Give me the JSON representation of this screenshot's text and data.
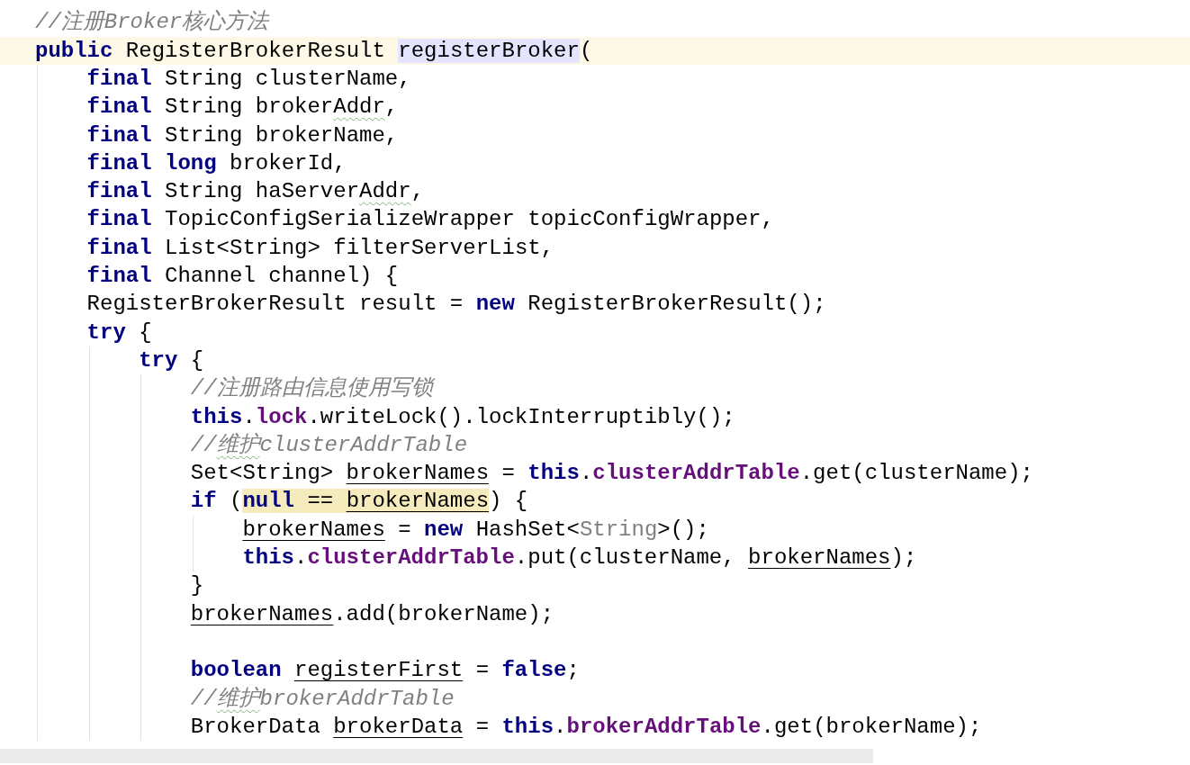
{
  "editor": {
    "lines": [
      {
        "tokens": [
          {
            "text": "//注册Broker核心方法",
            "kind": "comment"
          }
        ]
      },
      {
        "current": true,
        "tokens": [
          {
            "text": "public",
            "kind": "keyword"
          },
          {
            "text": " RegisterBrokerResult ",
            "kind": "plain"
          },
          {
            "text": "registerBroker",
            "kind": "plain",
            "color": "#e4e4ff"
          },
          {
            "text": "(",
            "kind": "plain"
          }
        ],
        "children": [
          {
            "tokens": [
              {
                "text": "final",
                "kind": "keyword"
              },
              {
                "text": " String clusterName,",
                "kind": "plain"
              }
            ]
          },
          {
            "tokens": [
              {
                "text": "final",
                "kind": "keyword"
              },
              {
                "text": " String broker",
                "kind": "plain"
              },
              {
                "text": "Addr",
                "kind": "plain",
                "typo": true
              },
              {
                "text": ",",
                "kind": "plain"
              }
            ]
          },
          {
            "tokens": [
              {
                "text": "final",
                "kind": "keyword"
              },
              {
                "text": " String brokerName,",
                "kind": "plain"
              }
            ]
          },
          {
            "tokens": [
              {
                "text": "final",
                "kind": "keyword"
              },
              {
                "text": " long",
                "kind": "keyword"
              },
              {
                "text": " brokerId,",
                "kind": "plain"
              }
            ]
          },
          {
            "tokens": [
              {
                "text": "final",
                "kind": "keyword"
              },
              {
                "text": " String haServer",
                "kind": "plain"
              },
              {
                "text": "Addr",
                "kind": "plain",
                "typo": true
              },
              {
                "text": ",",
                "kind": "plain"
              }
            ]
          },
          {
            "tokens": [
              {
                "text": "final",
                "kind": "keyword"
              },
              {
                "text": " TopicConfigSerializeWrapper topicConfigWrapper,",
                "kind": "plain"
              }
            ]
          },
          {
            "tokens": [
              {
                "text": "final",
                "kind": "keyword"
              },
              {
                "text": " List<String> filterServerList,",
                "kind": "plain"
              }
            ]
          },
          {
            "tokens": [
              {
                "text": "final",
                "kind": "keyword"
              },
              {
                "text": " Channel channel) {",
                "kind": "plain"
              }
            ]
          },
          {
            "tokens": [
              {
                "text": "RegisterBrokerResult result = ",
                "kind": "plain"
              },
              {
                "text": "new",
                "kind": "keyword"
              },
              {
                "text": " RegisterBrokerResult();",
                "kind": "plain"
              }
            ]
          },
          {
            "tokens": [
              {
                "text": "try",
                "kind": "keyword"
              },
              {
                "text": " {",
                "kind": "plain"
              }
            ],
            "children": [
              {
                "tokens": [
                  {
                    "text": "try",
                    "kind": "keyword"
                  },
                  {
                    "text": " {",
                    "kind": "plain"
                  }
                ],
                "children": [
                  {
                    "tokens": [
                      {
                        "text": "//注册路由信息使用写锁",
                        "kind": "comment"
                      }
                    ]
                  },
                  {
                    "tokens": [
                      {
                        "text": "this",
                        "kind": "keyword"
                      },
                      {
                        "text": ".",
                        "kind": "plain"
                      },
                      {
                        "text": "lock",
                        "kind": "field"
                      },
                      {
                        "text": ".writeLock().lockInterruptibly();",
                        "kind": "plain"
                      }
                    ]
                  },
                  {
                    "tokens": [
                      {
                        "text": "//",
                        "kind": "comment"
                      },
                      {
                        "text": "维护",
                        "kind": "comment",
                        "typo": true
                      },
                      {
                        "text": "clusterAddrTable",
                        "kind": "comment"
                      }
                    ]
                  },
                  {
                    "tokens": [
                      {
                        "text": "Set<String> ",
                        "kind": "plain"
                      },
                      {
                        "text": "brokerNames",
                        "kind": "variable"
                      },
                      {
                        "text": " = ",
                        "kind": "plain"
                      },
                      {
                        "text": "this",
                        "kind": "keyword"
                      },
                      {
                        "text": ".",
                        "kind": "plain"
                      },
                      {
                        "text": "clusterAddrTable",
                        "kind": "field"
                      },
                      {
                        "text": ".get(clusterName);",
                        "kind": "plain"
                      }
                    ]
                  },
                  {
                    "tokens": [
                      {
                        "text": "if",
                        "kind": "keyword"
                      },
                      {
                        "text": " (",
                        "kind": "plain"
                      },
                      {
                        "text": "null",
                        "kind": "keyword",
                        "color": "#f6ebbc"
                      },
                      {
                        "text": " == ",
                        "kind": "plain",
                        "color": "#f6ebbc"
                      },
                      {
                        "text": "brokerNames",
                        "kind": "variable",
                        "color": "#f6ebbc"
                      },
                      {
                        "text": ") {",
                        "kind": "plain"
                      }
                    ],
                    "children": [
                      {
                        "tokens": [
                          {
                            "text": "brokerNames",
                            "kind": "variable"
                          },
                          {
                            "text": " = ",
                            "kind": "plain"
                          },
                          {
                            "text": "new",
                            "kind": "keyword"
                          },
                          {
                            "text": " HashSet<",
                            "kind": "plain"
                          },
                          {
                            "text": "String",
                            "kind": "inferred"
                          },
                          {
                            "text": ">();",
                            "kind": "plain"
                          }
                        ]
                      },
                      {
                        "tokens": [
                          {
                            "text": "this",
                            "kind": "keyword"
                          },
                          {
                            "text": ".",
                            "kind": "plain"
                          },
                          {
                            "text": "clusterAddrTable",
                            "kind": "field"
                          },
                          {
                            "text": ".put(clusterName, ",
                            "kind": "plain"
                          },
                          {
                            "text": "brokerNames",
                            "kind": "variable"
                          },
                          {
                            "text": ");",
                            "kind": "plain"
                          }
                        ]
                      }
                    ]
                  },
                  {
                    "tokens": [
                      {
                        "text": "}",
                        "kind": "plain"
                      }
                    ]
                  },
                  {
                    "tokens": [
                      {
                        "text": "brokerNames",
                        "kind": "variable"
                      },
                      {
                        "text": ".add(brokerName);",
                        "kind": "plain"
                      }
                    ]
                  },
                  {
                    "blank": true
                  },
                  {
                    "tokens": [
                      {
                        "text": "boolean ",
                        "kind": "keyword"
                      },
                      {
                        "text": "registerFirst",
                        "kind": "variable"
                      },
                      {
                        "text": " = ",
                        "kind": "plain"
                      },
                      {
                        "text": "false",
                        "kind": "keyword"
                      },
                      {
                        "text": ";",
                        "kind": "plain"
                      }
                    ]
                  },
                  {
                    "tokens": [
                      {
                        "text": "//",
                        "kind": "comment"
                      },
                      {
                        "text": "维护",
                        "kind": "comment",
                        "typo": true
                      },
                      {
                        "text": "brokerAddrTable",
                        "kind": "comment"
                      }
                    ]
                  },
                  {
                    "tokens": [
                      {
                        "text": "BrokerData ",
                        "kind": "plain"
                      },
                      {
                        "text": "brokerData",
                        "kind": "variable"
                      },
                      {
                        "text": " = ",
                        "kind": "plain"
                      },
                      {
                        "text": "this",
                        "kind": "keyword"
                      },
                      {
                        "text": ".",
                        "kind": "plain"
                      },
                      {
                        "text": "brokerAddrTable",
                        "kind": "field"
                      },
                      {
                        "text": ".get(brokerName);",
                        "kind": "plain"
                      }
                    ]
                  }
                ]
              }
            ]
          }
        ]
      }
    ]
  }
}
